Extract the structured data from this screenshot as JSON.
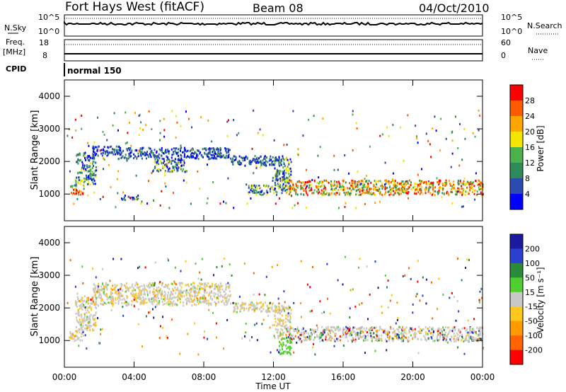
{
  "header": {
    "radar": "Fort Hays West (fitACF)",
    "beam": "Beam 08",
    "date": "04/Oct/2010"
  },
  "top_panels": {
    "nsky_label": "N.Sky",
    "nsky_tick_hi": "10^5",
    "nsky_tick_lo": "10^0",
    "nsky_right_hi": "10^5",
    "nsky_right_lo": "10^0",
    "nsearch_label": "N.Search",
    "freq_label_1": "Freq.",
    "freq_label_2": "[MHz]",
    "freq_tick_hi": "18",
    "freq_tick_lo": "8",
    "nave_tick_hi": "60",
    "nave_tick_lo": "0",
    "nave_label": "Nave",
    "cpid_label": "CPID",
    "cpid_value": "normal 150"
  },
  "axes": {
    "ylabel": "Slant Range [km]",
    "yticks": [
      "1000",
      "2000",
      "3000",
      "4000"
    ],
    "xticks": [
      "00:00",
      "04:00",
      "08:00",
      "12:00",
      "16:00",
      "20:00",
      "00:00"
    ],
    "xlabel": "Time UT"
  },
  "power_scale": {
    "label": "Power [dB]",
    "ticks": [
      "4",
      "8",
      "12",
      "16",
      "20",
      "24",
      "28"
    ],
    "colors": [
      "#0000ff",
      "#2c4bb0",
      "#2e8b57",
      "#4bb14b",
      "#f2e600",
      "#ffa500",
      "#ff5a00",
      "#ff0000"
    ]
  },
  "velocity_scale": {
    "label": "Velocity [m s⁻¹]",
    "ticks": [
      "200",
      "100",
      "50",
      "15",
      "-15",
      "-50",
      "-100",
      "-200"
    ],
    "colors": [
      "#1a1aa0",
      "#2a40d0",
      "#2a8a3a",
      "#4fcf2f",
      "#c8c8c8",
      "#ffc81e",
      "#ff9a00",
      "#ff6400",
      "#ff0000"
    ]
  },
  "chart_data": [
    {
      "type": "heatmap",
      "title": "Power",
      "xlabel": "Time UT",
      "ylabel": "Slant Range [km]",
      "xlim": [
        "00:00",
        "24:00"
      ],
      "ylim": [
        180,
        4500
      ],
      "colorbar": {
        "label": "Power [dB]",
        "range": [
          0,
          32
        ]
      },
      "bands": [
        {
          "start_h": 0.3,
          "end_h": 1.1,
          "range_km": [
            1000,
            1300
          ],
          "level": "high"
        },
        {
          "start_h": 0.6,
          "end_h": 1.8,
          "range_km": [
            1300,
            2300
          ],
          "level": "mid"
        },
        {
          "start_h": 1.6,
          "end_h": 3.2,
          "range_km": [
            2200,
            2500
          ],
          "level": "low"
        },
        {
          "start_h": 3.0,
          "end_h": 9.5,
          "range_km": [
            2100,
            2450
          ],
          "level": "low"
        },
        {
          "start_h": 5.0,
          "end_h": 7.0,
          "range_km": [
            1700,
            2100
          ],
          "level": "mid"
        },
        {
          "start_h": 9.5,
          "end_h": 12.3,
          "range_km": [
            1900,
            2200
          ],
          "level": "low"
        },
        {
          "start_h": 12.0,
          "end_h": 13.0,
          "range_km": [
            1100,
            2100
          ],
          "level": "mid"
        },
        {
          "start_h": 10.5,
          "end_h": 12.2,
          "range_km": [
            1000,
            1300
          ],
          "level": "mid"
        },
        {
          "start_h": 12.7,
          "end_h": 24.0,
          "range_km": [
            1000,
            1450
          ],
          "level": "high"
        },
        {
          "start_h": 3.2,
          "end_h": 4.2,
          "range_km": [
            850,
            1000
          ],
          "level": "low"
        }
      ]
    },
    {
      "type": "heatmap",
      "title": "Velocity",
      "xlabel": "Time UT",
      "ylabel": "Slant Range [km]",
      "xlim": [
        "00:00",
        "24:00"
      ],
      "ylim": [
        180,
        4500
      ],
      "colorbar": {
        "label": "Velocity [m s⁻¹]",
        "range": [
          -250,
          250
        ]
      },
      "bands": [
        {
          "start_h": 0.3,
          "end_h": 1.1,
          "range_km": [
            1000,
            1300
          ],
          "level": "slow"
        },
        {
          "start_h": 0.6,
          "end_h": 1.8,
          "range_km": [
            1300,
            2400
          ],
          "level": "slow"
        },
        {
          "start_h": 1.6,
          "end_h": 9.5,
          "range_km": [
            2100,
            2800
          ],
          "level": "slow"
        },
        {
          "start_h": 9.5,
          "end_h": 12.3,
          "range_km": [
            1900,
            2200
          ],
          "level": "slow"
        },
        {
          "start_h": 12.0,
          "end_h": 13.0,
          "range_km": [
            1100,
            2100
          ],
          "level": "slow"
        },
        {
          "start_h": 12.3,
          "end_h": 13.0,
          "range_km": [
            600,
            1100
          ],
          "level": "fast-positive"
        },
        {
          "start_h": 12.7,
          "end_h": 24.0,
          "range_km": [
            1000,
            1450
          ],
          "level": "mixed"
        }
      ]
    }
  ]
}
